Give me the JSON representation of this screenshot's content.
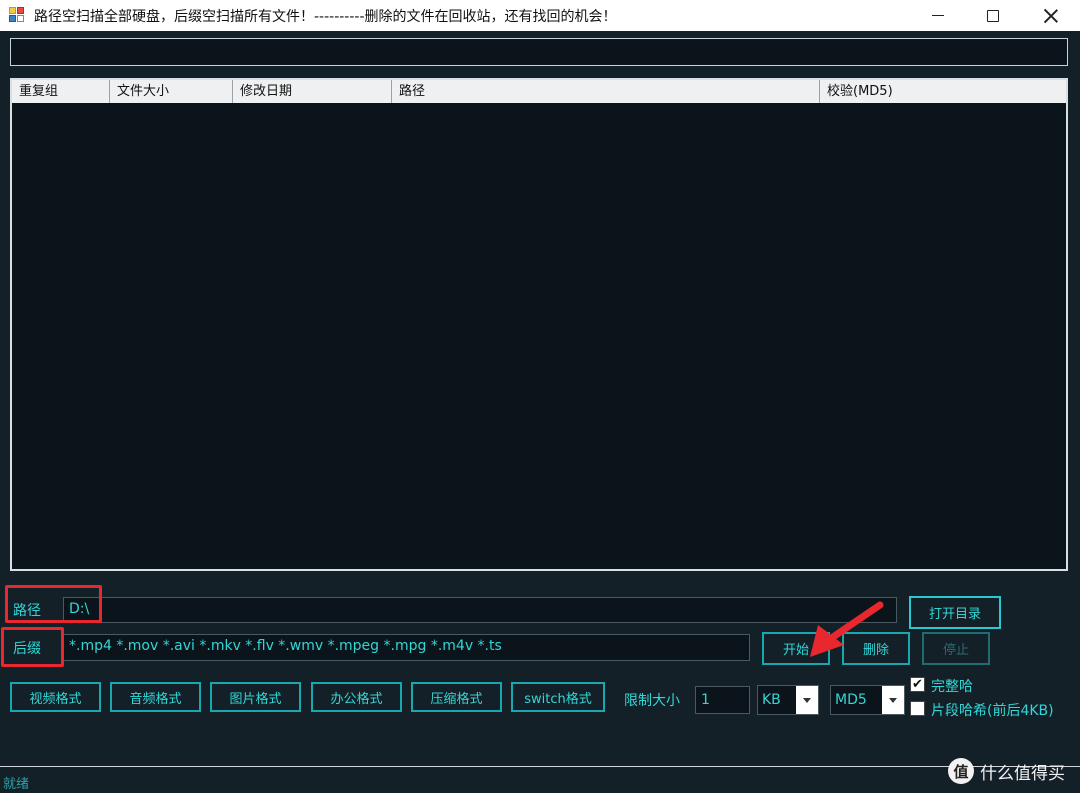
{
  "window": {
    "title": "路径空扫描全部硬盘，后缀空扫描所有文件！----------删除的文件在回收站，还有找回的机会！"
  },
  "grid": {
    "columns": [
      "重复组",
      "文件大小",
      "修改日期",
      "路径",
      "校验(MD5)"
    ]
  },
  "path": {
    "label": "路径",
    "value": "D:\\"
  },
  "suffix": {
    "label": "后缀",
    "value": "*.mp4 *.mov *.avi *.mkv *.flv *.wmv *.mpeg *.mpg *.m4v *.ts"
  },
  "buttons": {
    "open_dir": "打开目录",
    "start": "开始",
    "delete": "删除",
    "stop": "停止"
  },
  "formats": [
    "视频格式",
    "音频格式",
    "图片格式",
    "办公格式",
    "压缩格式",
    "switch格式"
  ],
  "limit": {
    "label": "限制大小",
    "value": "1",
    "unit": "KB",
    "hash": "MD5"
  },
  "options": {
    "full_hash": {
      "label": "完整哈",
      "checked": true
    },
    "partial_hash": {
      "label": "片段哈希(前后4KB)",
      "checked": false
    }
  },
  "status": {
    "text": "就绪"
  },
  "watermark": {
    "logo": "值",
    "text": "什么值得买"
  },
  "colors": {
    "background": "#132028",
    "accent": "#33d6d6",
    "highlight": "#e8282e"
  }
}
